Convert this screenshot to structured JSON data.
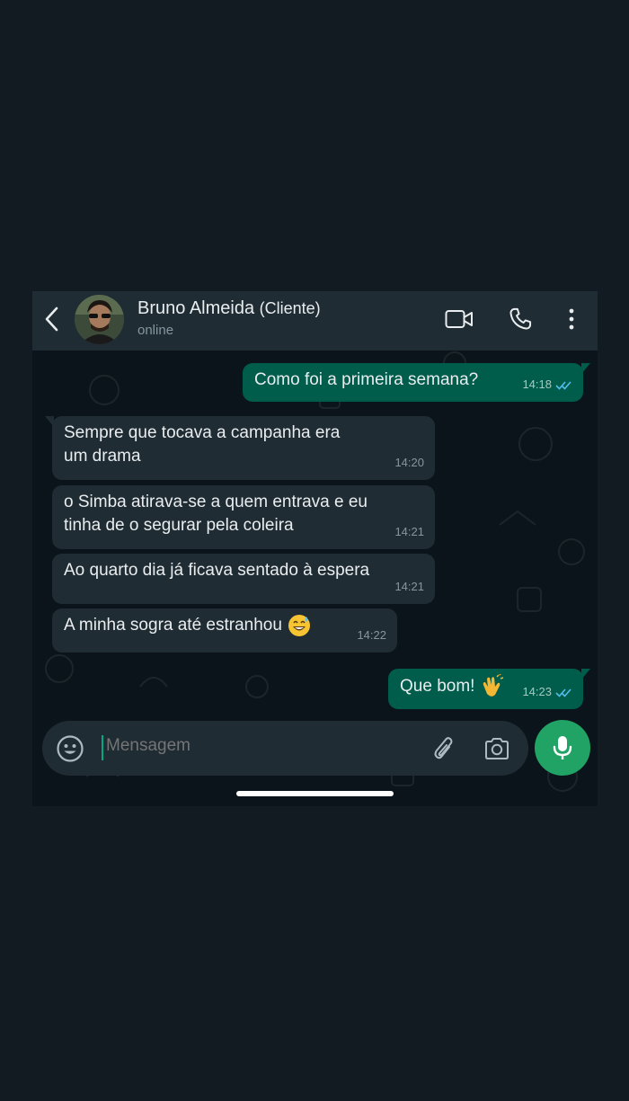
{
  "header": {
    "back_icon": "chevron-left-icon",
    "name": "Bruno Almeida",
    "name_tag": "(Cliente)",
    "status": "online",
    "video_icon": "video-camera-icon",
    "call_icon": "phone-icon",
    "menu_icon": "more-vertical-icon"
  },
  "messages": [
    {
      "direction": "out",
      "text": "Como foi a primeira semana?",
      "time": "14:18",
      "status": "read"
    },
    {
      "direction": "in",
      "text_line1": "Sempre que tocava a campanha era",
      "text_line2": "um drama",
      "time": "14:20"
    },
    {
      "direction": "in",
      "text_line1": "o Simba atirava-se a quem entrava e eu",
      "text_line2": "tinha de o segurar pela coleira",
      "time": "14:21"
    },
    {
      "direction": "in",
      "text": "Ao quarto dia já ficava sentado à espera",
      "time": "14:21"
    },
    {
      "direction": "in",
      "text": "A minha sogra até estranhou",
      "emoji": "grinning-sweat-emoji",
      "time": "14:22"
    },
    {
      "direction": "out",
      "text": "Que bom!",
      "emoji": "clapping-hands-emoji",
      "time": "14:23",
      "status": "read"
    }
  ],
  "composer": {
    "placeholder": "Mensagem",
    "emoji_icon": "smiley-icon",
    "attach_icon": "paperclip-icon",
    "camera_icon": "camera-icon",
    "mic_icon": "microphone-icon"
  },
  "colors": {
    "background": "#111b21",
    "header": "#1f2c33",
    "incoming_bubble": "#202c33",
    "outgoing_bubble": "#005c4b",
    "accent": "#21a366",
    "read_ticks": "#53bdeb"
  }
}
